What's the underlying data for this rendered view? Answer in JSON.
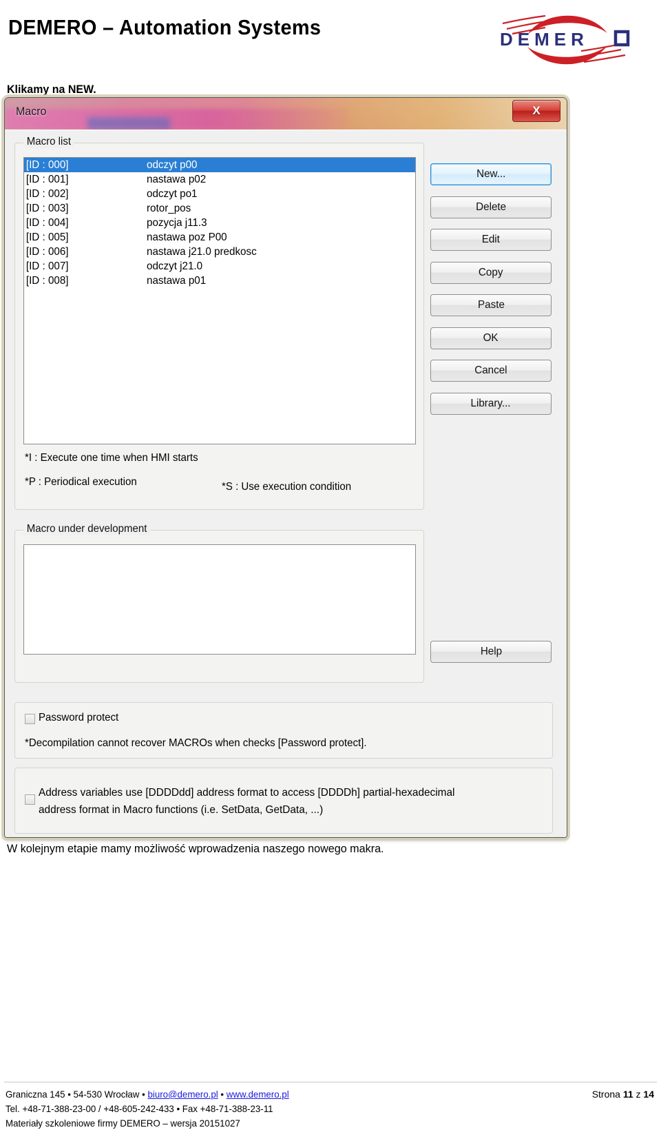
{
  "header": {
    "brand_title": "DEMERO – Automation Systems",
    "logo_text": "DEMERO",
    "logo_navy": "#2b2f7a",
    "logo_red": "#cc2026"
  },
  "intro_text": "Klikamy na NEW.",
  "dialog": {
    "title": "Macro",
    "close_glyph": "X",
    "macro_list": {
      "legend": "Macro list",
      "rows": [
        {
          "id": "[ID : 000]",
          "name": "odczyt p00",
          "selected": true
        },
        {
          "id": "[ID : 001]",
          "name": "nastawa p02",
          "selected": false
        },
        {
          "id": "[ID : 002]",
          "name": "odczyt po1",
          "selected": false
        },
        {
          "id": "[ID : 003]",
          "name": "rotor_pos",
          "selected": false
        },
        {
          "id": "[ID : 004]",
          "name": "pozycja j11.3",
          "selected": false
        },
        {
          "id": "[ID : 005]",
          "name": "nastawa poz P00",
          "selected": false
        },
        {
          "id": "[ID : 006]",
          "name": "nastawa j21.0 predkosc",
          "selected": false
        },
        {
          "id": "[ID : 007]",
          "name": "odczyt j21.0",
          "selected": false
        },
        {
          "id": "[ID : 008]",
          "name": "nastawa p01",
          "selected": false
        }
      ],
      "note_i": "*I : Execute one time when HMI starts",
      "note_p": "*P : Periodical execution",
      "note_s": "*S : Use execution condition"
    },
    "macro_dev": {
      "legend": "Macro under development",
      "content": ""
    },
    "buttons": {
      "new": "New...",
      "delete": "Delete",
      "edit": "Edit",
      "copy": "Copy",
      "paste": "Paste",
      "ok": "OK",
      "cancel": "Cancel",
      "library": "Library...",
      "help": "Help"
    },
    "password_panel": {
      "checkbox_label": "Password protect",
      "checked": false,
      "note": "*Decompilation cannot recover MACROs when checks [Password protect]."
    },
    "address_panel": {
      "checked": false,
      "text": "Address variables use [DDDDdd] address format to access [DDDDh] partial-hexadecimal\naddress format in Macro functions (i.e. SetData, GetData, ...)"
    }
  },
  "caption_text": "W kolejnym etapie mamy możliwość wprowadzenia naszego nowego makra.",
  "footer": {
    "line1_pre": "Graniczna 145 • 54-530 Wrocław • ",
    "email": "biuro@demero.pl",
    "sep": " • ",
    "website": "www.demero.pl",
    "line2": "Tel. +48-71-388-23-00 / +48-605-242-433 • Fax +48-71-388-23-11",
    "line3": "Materiały szkoleniowe firmy DEMERO – wersja 20151027",
    "page_pre": "Strona ",
    "page_num": "11",
    "page_mid": " z ",
    "page_total": "14"
  }
}
